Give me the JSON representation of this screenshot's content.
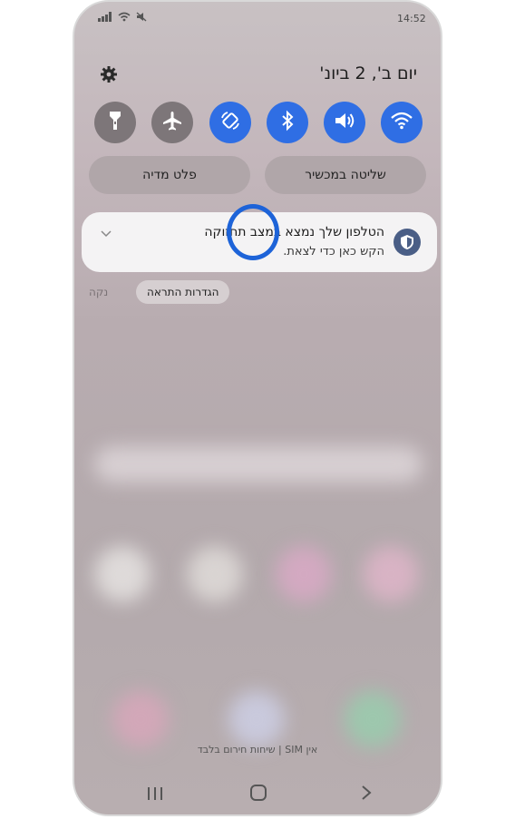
{
  "status_bar": {
    "time": "14:52",
    "left_icons": [
      "signal-icon",
      "wifi-icon",
      "mute-icon"
    ]
  },
  "header": {
    "date": "יום ב', 2 ביונ'"
  },
  "quick_settings": {
    "toggles": [
      {
        "name": "wifi",
        "icon": "wifi-icon",
        "state": "on"
      },
      {
        "name": "sound",
        "icon": "volume-icon",
        "state": "on"
      },
      {
        "name": "bluetooth",
        "icon": "bluetooth-icon",
        "state": "on"
      },
      {
        "name": "auto-rotate",
        "icon": "rotate-icon",
        "state": "on"
      },
      {
        "name": "airplane-mode",
        "icon": "airplane-icon",
        "state": "off"
      },
      {
        "name": "flashlight",
        "icon": "flashlight-icon",
        "state": "off"
      }
    ],
    "device_control_label": "שליטה במכשיר",
    "media_output_label": "פלט מדיה"
  },
  "notification": {
    "title": "הטלפון שלך נמצא במצב תחזוקה",
    "subtitle": "הקש כאן כדי לצאת."
  },
  "notification_actions": {
    "settings_label": "הגדרות התראה",
    "clear_label": "נקה"
  },
  "footer": {
    "sim_text": "אין SIM | שיחות חירום בלבד"
  },
  "colors": {
    "accent": "#2f6ee4",
    "highlight_ring": "#1d63d8"
  }
}
